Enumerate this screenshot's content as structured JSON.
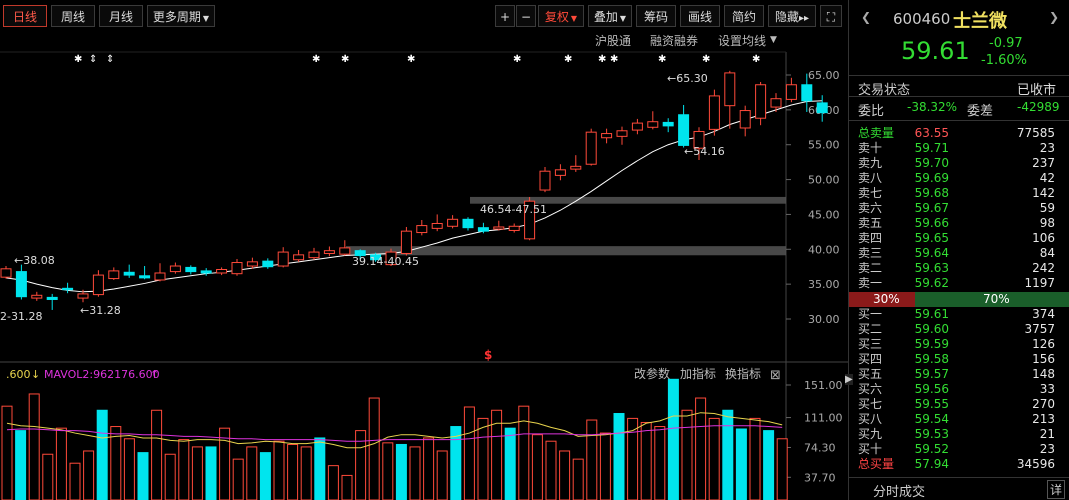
{
  "toolbar": {
    "tabs": [
      "日线",
      "周线",
      "月线",
      "更多周期"
    ],
    "right_buttons": [
      "复权",
      "叠加",
      "筹码",
      "画线",
      "简约",
      "隐藏"
    ],
    "plus": "+",
    "minus": "−",
    "expand": "▸▸",
    "fullscreen": "⛶"
  },
  "subbar": {
    "hugutong": "沪股通",
    "rongzi": "融资融券",
    "ma_settings": "设置均线"
  },
  "chart_data": [
    {
      "type": "candlestick",
      "title": "",
      "ylim": [
        28,
        67
      ],
      "y_ticks": [
        "65.00",
        "60.00",
        "55.00",
        "50.00",
        "45.00",
        "40.00",
        "35.00",
        "30.00"
      ],
      "candles": [
        {
          "o": 36.0,
          "c": 37.2,
          "h": 37.6,
          "l": 35.8
        },
        {
          "o": 36.8,
          "c": 33.2,
          "h": 37.8,
          "l": 32.8
        },
        {
          "o": 33.0,
          "c": 33.4,
          "h": 33.9,
          "l": 32.6
        },
        {
          "o": 33.1,
          "c": 32.8,
          "h": 33.6,
          "l": 31.3
        },
        {
          "o": 34.4,
          "c": 34.2,
          "h": 35.2,
          "l": 33.7
        },
        {
          "o": 33.0,
          "c": 33.6,
          "h": 34.2,
          "l": 32.4
        },
        {
          "o": 33.5,
          "c": 36.3,
          "h": 37.0,
          "l": 33.2
        },
        {
          "o": 35.8,
          "c": 36.9,
          "h": 37.4,
          "l": 35.6
        },
        {
          "o": 36.7,
          "c": 36.3,
          "h": 37.8,
          "l": 35.9
        },
        {
          "o": 36.2,
          "c": 35.9,
          "h": 37.6,
          "l": 35.7
        },
        {
          "o": 35.6,
          "c": 36.6,
          "h": 38.0,
          "l": 35.4
        },
        {
          "o": 36.8,
          "c": 37.6,
          "h": 38.1,
          "l": 36.5
        },
        {
          "o": 37.4,
          "c": 36.8,
          "h": 37.7,
          "l": 36.4
        },
        {
          "o": 36.9,
          "c": 36.6,
          "h": 37.3,
          "l": 36.2
        },
        {
          "o": 36.6,
          "c": 37.1,
          "h": 37.4,
          "l": 36.3
        },
        {
          "o": 36.5,
          "c": 38.1,
          "h": 38.6,
          "l": 36.2
        },
        {
          "o": 37.6,
          "c": 38.2,
          "h": 38.8,
          "l": 37.2
        },
        {
          "o": 38.3,
          "c": 37.5,
          "h": 38.7,
          "l": 37.2
        },
        {
          "o": 37.6,
          "c": 39.6,
          "h": 40.3,
          "l": 37.4
        },
        {
          "o": 38.5,
          "c": 39.2,
          "h": 39.9,
          "l": 38.2
        },
        {
          "o": 38.8,
          "c": 39.6,
          "h": 40.2,
          "l": 38.5
        },
        {
          "o": 39.4,
          "c": 39.8,
          "h": 40.4,
          "l": 39.0
        },
        {
          "o": 39.3,
          "c": 40.2,
          "h": 41.3,
          "l": 39.1
        },
        {
          "o": 39.8,
          "c": 39.1,
          "h": 40.0,
          "l": 38.6
        },
        {
          "o": 39.2,
          "c": 38.5,
          "h": 39.5,
          "l": 38.2
        },
        {
          "o": 37.8,
          "c": 39.6,
          "h": 40.1,
          "l": 37.6
        },
        {
          "o": 39.4,
          "c": 42.6,
          "h": 43.2,
          "l": 39.1
        },
        {
          "o": 42.4,
          "c": 43.4,
          "h": 44.2,
          "l": 42.0
        },
        {
          "o": 43.0,
          "c": 43.7,
          "h": 45.0,
          "l": 42.6
        },
        {
          "o": 43.3,
          "c": 44.3,
          "h": 44.9,
          "l": 43.0
        },
        {
          "o": 44.3,
          "c": 43.1,
          "h": 44.6,
          "l": 42.7
        },
        {
          "o": 43.1,
          "c": 42.6,
          "h": 43.8,
          "l": 42.3
        },
        {
          "o": 42.9,
          "c": 43.2,
          "h": 44.1,
          "l": 42.7
        },
        {
          "o": 42.7,
          "c": 43.3,
          "h": 43.7,
          "l": 42.4
        },
        {
          "o": 41.5,
          "c": 46.9,
          "h": 47.5,
          "l": 41.3
        },
        {
          "o": 48.5,
          "c": 51.2,
          "h": 51.8,
          "l": 48.2
        },
        {
          "o": 50.6,
          "c": 51.4,
          "h": 52.2,
          "l": 49.9
        },
        {
          "o": 51.5,
          "c": 51.9,
          "h": 53.5,
          "l": 51.1
        },
        {
          "o": 52.2,
          "c": 56.8,
          "h": 57.3,
          "l": 52.0
        },
        {
          "o": 56.0,
          "c": 56.6,
          "h": 57.3,
          "l": 55.2
        },
        {
          "o": 56.2,
          "c": 57.0,
          "h": 57.6,
          "l": 55.0
        },
        {
          "o": 57.1,
          "c": 58.1,
          "h": 58.7,
          "l": 56.5
        },
        {
          "o": 57.5,
          "c": 58.3,
          "h": 59.8,
          "l": 57.2
        },
        {
          "o": 58.2,
          "c": 57.7,
          "h": 58.8,
          "l": 56.8
        },
        {
          "o": 59.3,
          "c": 54.9,
          "h": 60.7,
          "l": 54.6
        },
        {
          "o": 54.5,
          "c": 56.9,
          "h": 57.5,
          "l": 52.8
        },
        {
          "o": 57.2,
          "c": 62.0,
          "h": 62.9,
          "l": 56.3
        },
        {
          "o": 60.6,
          "c": 65.3,
          "h": 65.6,
          "l": 57.3
        },
        {
          "o": 57.4,
          "c": 59.9,
          "h": 60.6,
          "l": 56.2
        },
        {
          "o": 58.8,
          "c": 63.6,
          "h": 64.0,
          "l": 57.8
        },
        {
          "o": 60.4,
          "c": 61.6,
          "h": 62.4,
          "l": 59.7
        },
        {
          "o": 61.5,
          "c": 63.6,
          "h": 64.6,
          "l": 61.1
        },
        {
          "o": 63.6,
          "c": 61.3,
          "h": 65.2,
          "l": 59.7
        },
        {
          "o": 61.0,
          "c": 59.6,
          "h": 62.1,
          "l": 58.3
        }
      ],
      "ma": [
        35.9,
        35.6,
        35.0,
        34.5,
        34.1,
        33.9,
        34.0,
        34.3,
        34.7,
        35.1,
        35.6,
        35.9,
        36.2,
        36.5,
        36.7,
        37.0,
        37.3,
        37.6,
        37.9,
        38.2,
        38.5,
        38.8,
        39.1,
        39.2,
        39.3,
        39.4,
        39.7,
        40.3,
        40.9,
        41.6,
        42.1,
        42.6,
        42.8,
        43.1,
        43.6,
        44.5,
        45.6,
        46.9,
        48.3,
        49.8,
        51.3,
        52.7,
        54.0,
        55.0,
        55.7,
        56.1,
        56.9,
        57.9,
        58.6,
        59.3,
        60.0,
        60.7,
        61.2,
        61.3
      ],
      "annotations": [
        {
          "text": "38.08"
        },
        {
          "text": "31.28"
        },
        {
          "text": "39.14-40.45"
        },
        {
          "text": "46.54-47.51"
        },
        {
          "text": "65.30"
        },
        {
          "text": "54.16"
        }
      ],
      "gaps": [
        [
          39.14,
          40.45
        ],
        [
          46.54,
          47.51
        ]
      ],
      "left_cut_label": "2-31.28"
    },
    {
      "type": "bar",
      "title": "",
      "ylim": [
        30,
        165
      ],
      "y_ticks": [
        "151.00",
        "111.00",
        "74.30",
        "37.70"
      ],
      "indicator_vol_label": ".600",
      "indicator_mavol2_label": "MAVOL2:962176.600",
      "values": [
        125,
        95,
        140,
        66,
        98,
        55,
        70,
        120,
        100,
        85,
        68,
        120,
        66,
        84,
        75,
        75,
        98,
        60,
        75,
        68,
        82,
        78,
        75,
        86,
        52,
        40,
        95,
        135,
        80,
        78,
        75,
        86,
        70,
        100,
        124,
        110,
        120,
        98,
        125,
        90,
        82,
        70,
        60,
        108,
        92,
        116,
        110,
        105,
        100,
        158,
        120,
        135,
        110,
        120,
        97,
        110,
        95,
        85
      ],
      "ma1": [
        104,
        101,
        100,
        98,
        96,
        92,
        89,
        86,
        88,
        89,
        86,
        86,
        83,
        82,
        84,
        84,
        83,
        79,
        80,
        82,
        81,
        79,
        79,
        81,
        78,
        74,
        74,
        79,
        87,
        90,
        90,
        88,
        86,
        88,
        92,
        99,
        104,
        104,
        107,
        104,
        99,
        95,
        88,
        89,
        90,
        92,
        95,
        104,
        107,
        113,
        113,
        117,
        116,
        112,
        110,
        108,
        106,
        102
      ],
      "ma2": [
        96,
        97,
        97,
        96,
        95,
        95,
        94,
        92,
        91,
        91,
        90,
        90,
        89,
        88,
        88,
        87,
        86,
        85,
        85,
        84,
        84,
        84,
        84,
        84,
        83,
        82,
        82,
        83,
        84,
        84,
        84,
        84,
        84,
        84,
        85,
        87,
        88,
        89,
        91,
        91,
        91,
        91,
        90,
        90,
        91,
        92,
        93,
        95,
        96,
        98,
        99,
        100,
        101,
        101,
        101,
        101,
        100,
        99
      ],
      "gap_marker": "$"
    }
  ],
  "vol_header": {
    "gai_canshu": "改参数",
    "jia_zhibiao": "加指标",
    "huan_zhibiao": "换指标",
    "close": "⊠"
  },
  "quote": {
    "code": "600460",
    "name": "士兰微",
    "price": "59.61",
    "change": "-0.97",
    "change_pct": "-1.60%",
    "nav_left": "❮",
    "nav_right": "❯",
    "status_label": "交易状态",
    "status_value": "已收市",
    "weibi_label": "委比",
    "weibi_value": "-38.32%",
    "weicha_label": "委差",
    "weicha_value": "-42989",
    "total_sell_label": "总卖量",
    "total_sell_price": "63.55",
    "total_sell_vol": "77585",
    "asks": [
      {
        "label": "卖十",
        "price": "59.71",
        "vol": "23"
      },
      {
        "label": "卖九",
        "price": "59.70",
        "vol": "237"
      },
      {
        "label": "卖八",
        "price": "59.69",
        "vol": "42"
      },
      {
        "label": "卖七",
        "price": "59.68",
        "vol": "142"
      },
      {
        "label": "卖六",
        "price": "59.67",
        "vol": "59"
      },
      {
        "label": "卖五",
        "price": "59.66",
        "vol": "98"
      },
      {
        "label": "卖四",
        "price": "59.65",
        "vol": "106"
      },
      {
        "label": "卖三",
        "price": "59.64",
        "vol": "84"
      },
      {
        "label": "卖二",
        "price": "59.63",
        "vol": "242"
      },
      {
        "label": "卖一",
        "price": "59.62",
        "vol": "1197"
      }
    ],
    "ratio_buy": "30%",
    "ratio_sell": "70%",
    "buy_fraction": 0.3,
    "bids": [
      {
        "label": "买一",
        "price": "59.61",
        "vol": "374"
      },
      {
        "label": "买二",
        "price": "59.60",
        "vol": "3757"
      },
      {
        "label": "买三",
        "price": "59.59",
        "vol": "126"
      },
      {
        "label": "买四",
        "price": "59.58",
        "vol": "156"
      },
      {
        "label": "买五",
        "price": "59.57",
        "vol": "148"
      },
      {
        "label": "买六",
        "price": "59.56",
        "vol": "33"
      },
      {
        "label": "买七",
        "price": "59.55",
        "vol": "270"
      },
      {
        "label": "买八",
        "price": "59.54",
        "vol": "213"
      },
      {
        "label": "买九",
        "price": "59.53",
        "vol": "21"
      },
      {
        "label": "买十",
        "price": "59.52",
        "vol": "23"
      }
    ],
    "total_buy_label": "总买量",
    "total_buy_price": "57.94",
    "total_buy_vol": "34596",
    "trades_label": "分时成交",
    "detail_label": "详",
    "collapse": "▶"
  },
  "colors": {
    "up": "#ff4a3a",
    "down": "#00e5ee",
    "ma": "#ffffff",
    "mavol1": "#e8d44d",
    "mavol2": "#dd33dd",
    "gap": "#555555"
  },
  "event_marker": "✱"
}
